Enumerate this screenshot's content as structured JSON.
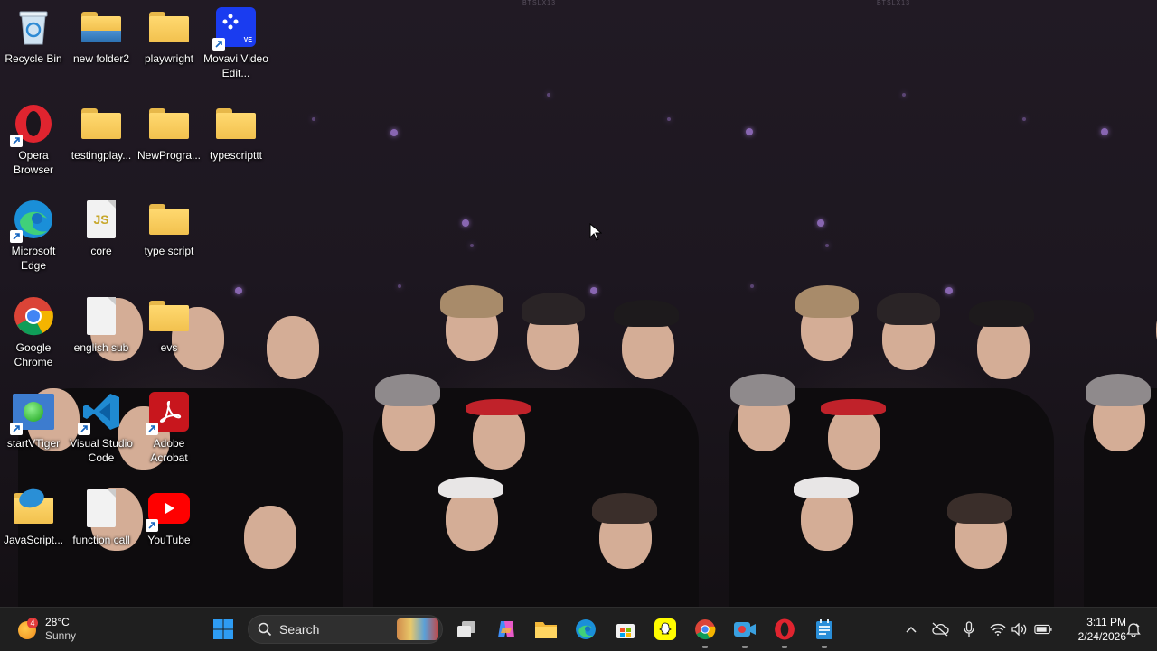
{
  "desktop": {
    "watermark": "BTSLX13",
    "icons": [
      {
        "label": "Recycle Bin"
      },
      {
        "label": "new folder2"
      },
      {
        "label": "playwright"
      },
      {
        "label": "Movavi Video Edit..."
      },
      {
        "label": "Opera Browser"
      },
      {
        "label": "testingplay..."
      },
      {
        "label": "NewProgra..."
      },
      {
        "label": "typescripttt"
      },
      {
        "label": "Microsoft Edge"
      },
      {
        "label": "core"
      },
      {
        "label": "type script"
      },
      {
        "label": "Google Chrome"
      },
      {
        "label": "english sub"
      },
      {
        "label": "evs"
      },
      {
        "label": "startVTiger"
      },
      {
        "label": "Visual Studio Code"
      },
      {
        "label": "Adobe Acrobat"
      },
      {
        "label": "JavaScript..."
      },
      {
        "label": "function call"
      },
      {
        "label": "YouTube"
      }
    ],
    "icon_glyphs": {
      "core": "JS",
      "movavi": "VE"
    }
  },
  "taskbar": {
    "weather": {
      "temp": "28°C",
      "condition": "Sunny",
      "badge": "4"
    },
    "search": {
      "label": "Search"
    },
    "clock": {
      "time": "3:11 PM",
      "date": "2/24/2026"
    }
  },
  "colors": {
    "accent": "#0078d4",
    "taskbar": "#1f1f1f",
    "folder": "#f2c14e"
  }
}
